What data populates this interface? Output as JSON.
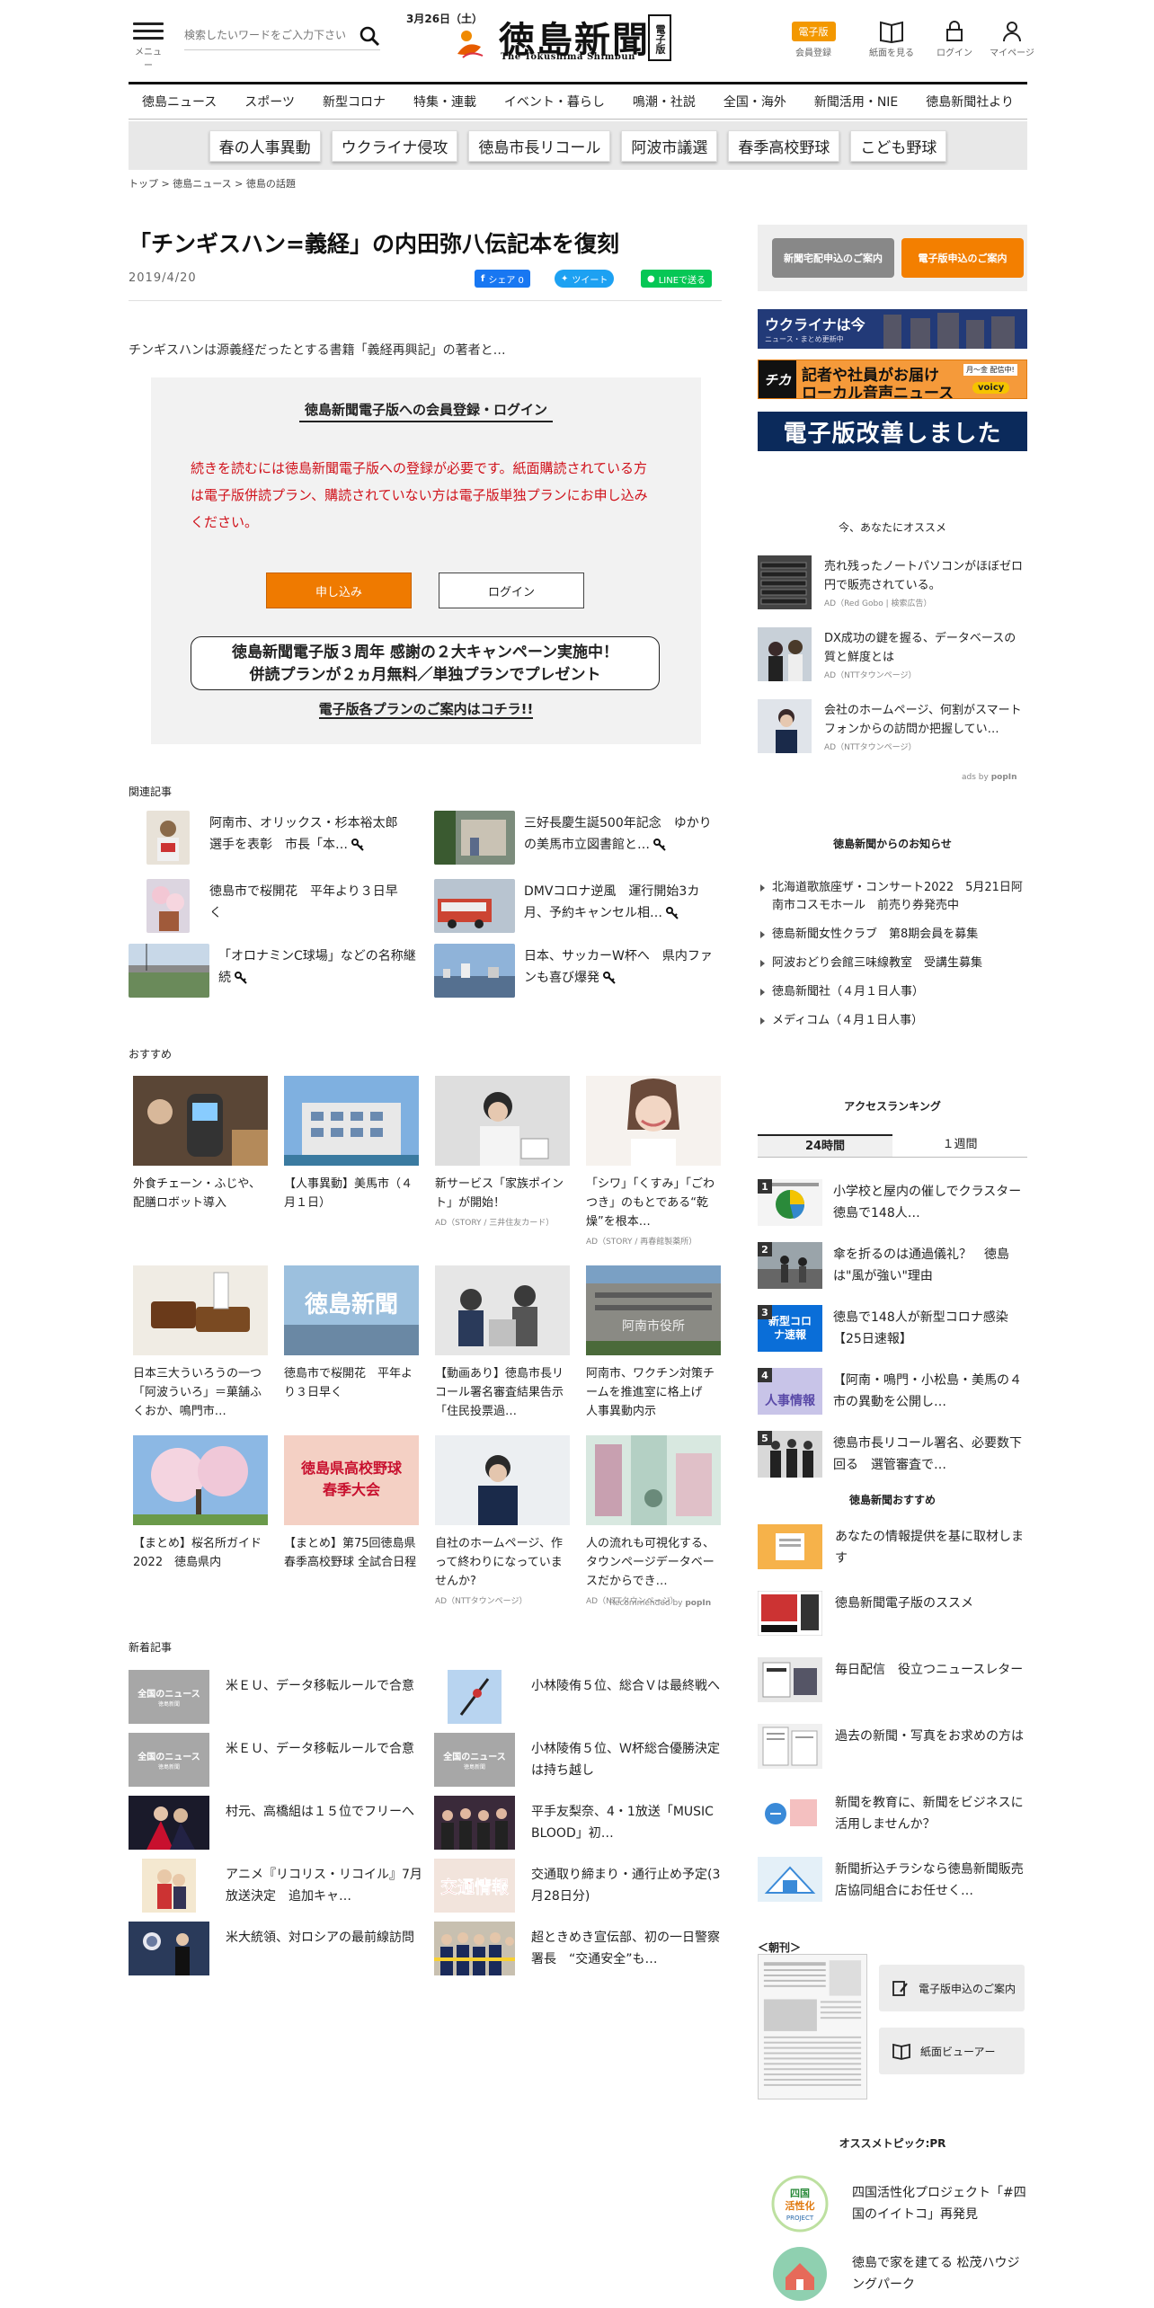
{
  "header": {
    "menu_label": "メニュー",
    "search_placeholder": "検索したいワードをご入力下さい",
    "date": "3月26日（土）",
    "logo_ja": "徳島新聞",
    "logo_en": "The Tokushima Shimbun",
    "logo_edition": "電子版",
    "edition_badge": "電子版",
    "member_register": "会員登録",
    "view_paper": "紙面を見る",
    "login": "ログイン",
    "mypage": "マイページ"
  },
  "nav": [
    "徳島ニュース",
    "スポーツ",
    "新型コロナ",
    "特集・連載",
    "イベント・暮らし",
    "鳴潮・社説",
    "全国・海外",
    "新聞活用・NIE",
    "徳島新聞社より"
  ],
  "tags": [
    "春の人事異動",
    "ウクライナ侵攻",
    "徳島市長リコール",
    "阿波市議選",
    "春季高校野球",
    "こども野球"
  ],
  "breadcrumb": {
    "home": "トップ",
    "sep1": ">",
    "cat": "徳島ニュース",
    "sep2": ">",
    "sub": "徳島の話題"
  },
  "article": {
    "title": "「チンギスハン=義経」の内田弥八伝記本を復刻",
    "date": "2019/4/20",
    "share_fb": "シェア 0",
    "share_tw": "ツイート",
    "share_line": "LINEで送る",
    "lead": "チンギスハンは源義経だったとする書籍「義経再興記」の著者と…"
  },
  "paywall": {
    "heading": "徳島新聞電子版への会員登録・ログイン",
    "text": "続きを読むには徳島新聞電子版への登録が必要です。紙面購読されている方は電子版併読プラン、購読されていない方は電子版単独プランにお申し込みください。",
    "apply": "申し込み",
    "login": "ログイン",
    "campaign_line1": "徳島新聞電子版３周年 感謝の２大キャンペーン実施中！",
    "campaign_line2": "併読プランが２ヵ月無料／単独プランでプレゼント",
    "plans_link": "電子版各プランのご案内はコチラ!!"
  },
  "related": {
    "heading": "関連記事",
    "items": [
      "阿南市、オリックス・杉本裕太郎選手を表彰　市長「本…",
      "三好長慶生誕500年記念　ゆかりの美馬市立図書館と…",
      "徳島市で桜開花　平年より３日早く",
      "DMVコロナ逆風　運行開始3カ月、予約キャンセル相…",
      "「オロナミンC球場」などの名称継続",
      "日本、サッカーW杯へ　県内ファンも喜び爆発"
    ]
  },
  "recommend": {
    "heading": "おすすめ",
    "items": [
      {
        "text": "外食チェーン・ふじや、配膳ロボット導入",
        "ad": ""
      },
      {
        "text": "【人事異動】美馬市（４月１日）",
        "ad": ""
      },
      {
        "text": "新サービス「家族ポイント」が開始！",
        "ad": "AD（STORY / 三井住友カード）"
      },
      {
        "text": "「シワ」「くすみ」「ごわつき」のもとである“乾燥”を根本…",
        "ad": "AD（STORY / 再春館製薬所）"
      },
      {
        "text": "日本三大ういろうの一つ「阿波ういろ」＝菓舗ふくおか、鳴門市…",
        "ad": ""
      },
      {
        "text": "徳島市で桜開花　平年より３日早く",
        "ad": ""
      },
      {
        "text": "【動画あり】徳島市長リコール署名審査結果告示　「住民投票過…",
        "ad": ""
      },
      {
        "text": "阿南市、ワクチン対策チームを推進室に格上げ　人事異動内示",
        "ad": ""
      },
      {
        "text": "【まとめ】桜名所ガイド2022　徳島県内",
        "ad": ""
      },
      {
        "text": "【まとめ】第75回徳島県春季高校野球 全試合日程",
        "ad": ""
      },
      {
        "text": "自社のホームページ、作って終わりになっていませんか?",
        "ad": "AD（NTTタウンページ）"
      },
      {
        "text": "人の流れも可視化する、タウンページデータベースだからでき…",
        "ad": "AD（NTTタウンページ）"
      }
    ],
    "thumb_text_1": "徳島新聞",
    "thumb_text_2": "阿南市役所",
    "thumb_text_3a": "徳島県高校野球",
    "thumb_text_3b": "春季大会",
    "powered": "Recommended by",
    "powered_brand": "popIn"
  },
  "new_articles": {
    "heading": "新着記事",
    "thumb_label": "全国のニュース",
    "thumb_sub": "徳島新聞",
    "traffic_thumb": "交通情報",
    "items": [
      "米ＥＵ、データ移転ルールで合意",
      "小林陵侑５位、総合Ｖは最終戦へ",
      "米ＥＵ、データ移転ルールで合意",
      "小林陵侑５位、Ｗ杯総合優勝決定は持ち越し",
      "村元、高橋組は１５位でフリーへ",
      "平手友梨奈、4・1放送「MUSIC BLOOD」初…",
      "アニメ『リコリス・リコイル』7月放送決定　追加キャ…",
      "交通取り締まり・通行止め予定(3月28日分)",
      "米大統領、対ロシアの最前線訪問",
      "超ときめき宣伝部、初の一日警察署長　“交通安全”も…"
    ]
  },
  "right": {
    "btn_home": "新聞宅配申込のご案内",
    "btn_digital": "電子版申込のご案内",
    "ukraine_title": "ウクライナは今",
    "ukraine_sub": "ニュース・まとめ更新中",
    "voice_logo": "チカ",
    "voice_main": "記者や社員がお届け",
    "voice_sub": "ローカル音声ニュース",
    "voice_tag": "月～金 配信中!",
    "voice_brand": "voicy",
    "kaizen": "電子版改善しました",
    "osusume_heading": "今、あなたにオススメ",
    "osusume": [
      {
        "text": "売れ残ったノートパソコンがほぼゼロ円で販売されている。",
        "ad": "AD（Red Gobo | 検索広告）"
      },
      {
        "text": "DX成功の鍵を握る、データベースの質と鮮度とは",
        "ad": "AD（NTTタウンページ）"
      },
      {
        "text": "会社のホームページ、何割がスマートフォンからの訪問か把握してい…",
        "ad": "AD（NTTタウンページ）"
      }
    ],
    "ads_by": "ads by",
    "ads_brand": "popIn",
    "notice_heading": "徳島新聞からのお知らせ",
    "notices": [
      "北海道歌旅座ザ・コンサート2022　5月21日阿南市コスモホール　前売り券発売中",
      "徳島新聞女性クラブ　第8期会員を募集",
      "阿波おどり会館三味線教室　受講生募集",
      "徳島新聞社（４月１日人事）",
      "メディコム（４月１日人事）"
    ],
    "ranking_heading": "アクセスランキング",
    "tab_24h": "24時間",
    "tab_week": "１週間",
    "ranking": [
      "小学校と屋内の催しでクラスター　徳島で148人…",
      "傘を折るのは通過儀礼？　徳島は\"風が強い\"理由",
      "徳島で148人が新型コロナ感染【25日速報】",
      "【阿南・鳴門・小松島・美馬の４市の異動を公開し…",
      "徳島市長リコール署名、必要数下回る　選管審査で…"
    ],
    "rank_numbers": [
      "1",
      "2",
      "3",
      "4",
      "5"
    ],
    "corona_thumb": "新型コロナ速報",
    "jinji_thumb": "人事情報",
    "tsb_heading": "徳島新聞おすすめ",
    "tsb": [
      "あなたの情報提供を基に取材します",
      "徳島新聞電子版のススメ",
      "毎日配信　役立つニュースレター",
      "過去の新聞・写真をお求めの方は",
      "新聞を教育に、新聞をビジネスに活用しませんか？",
      "新聞折込チラシなら徳島新聞販売店協同組合にお任せく…"
    ],
    "chokan": "＜朝刊＞",
    "side_btn_digital": "電子版申込のご案内",
    "side_btn_viewer": "紙面ビューアー",
    "pr_heading": "オススメトピック:PR",
    "pr": [
      "四国活性化プロジェクト「#四国のイイトコ」再発見",
      "徳島で家を建てる 松茂ハウジングパーク"
    ],
    "pr_logo_top": "四国",
    "pr_logo_mid": "活性化",
    "pr_logo_bot": "PROJECT"
  },
  "colors": {
    "orange": "#f39800",
    "nav_border": "#111111",
    "paywall_text": "#d0121b",
    "facebook": "#1877f2",
    "twitter": "#1da1f2",
    "line": "#06c755",
    "navy": "#0b2a5b"
  }
}
